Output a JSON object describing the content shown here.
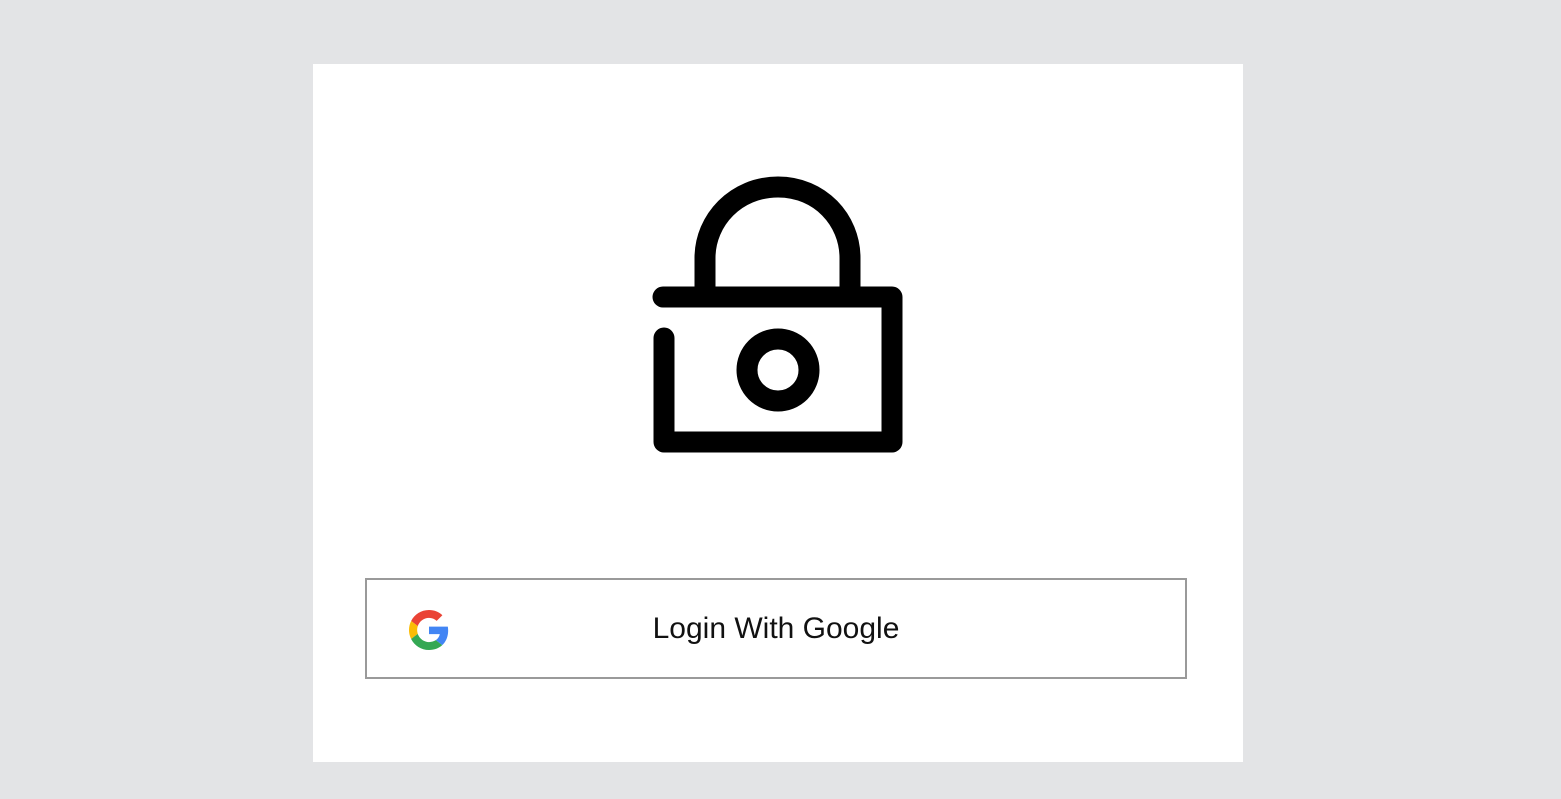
{
  "login": {
    "button_label": "Login With Google",
    "provider_icon": "google-g-icon",
    "hero_icon": "lock-icon"
  },
  "colors": {
    "background": "#e3e4e6",
    "card": "#ffffff",
    "button_border": "#9a9a9a",
    "icon_stroke": "#000000",
    "google_red": "#EA4335",
    "google_yellow": "#FBBC05",
    "google_green": "#34A853",
    "google_blue": "#4285F4"
  }
}
